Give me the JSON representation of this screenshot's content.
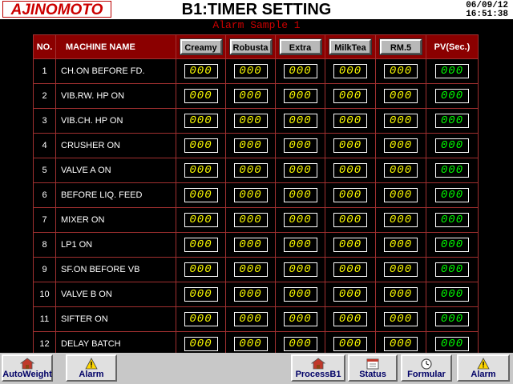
{
  "header": {
    "logo": "AJINOMOTO",
    "title": "B1:TIMER SETTING",
    "date": "06/09/12",
    "time": "16:51:38"
  },
  "alarm_banner": "Alarm Sample 1",
  "table": {
    "col_no": "NO.",
    "col_name": "MACHINE NAME",
    "col_buttons": [
      "Creamy",
      "Robusta",
      "Extra",
      "MilkTea",
      "RM.5"
    ],
    "col_pv": "PV(Sec.)",
    "rows": [
      {
        "no": "1",
        "name": "CH.ON BEFORE FD.",
        "values": [
          "000",
          "000",
          "000",
          "000",
          "000"
        ],
        "pv": "000"
      },
      {
        "no": "2",
        "name": "VIB.RW. HP ON",
        "values": [
          "000",
          "000",
          "000",
          "000",
          "000"
        ],
        "pv": "000"
      },
      {
        "no": "3",
        "name": "VIB.CH. HP ON",
        "values": [
          "000",
          "000",
          "000",
          "000",
          "000"
        ],
        "pv": "000"
      },
      {
        "no": "4",
        "name": "CRUSHER ON",
        "values": [
          "000",
          "000",
          "000",
          "000",
          "000"
        ],
        "pv": "000"
      },
      {
        "no": "5",
        "name": "VALVE A ON",
        "values": [
          "000",
          "000",
          "000",
          "000",
          "000"
        ],
        "pv": "000"
      },
      {
        "no": "6",
        "name": "BEFORE LIQ. FEED",
        "values": [
          "000",
          "000",
          "000",
          "000",
          "000"
        ],
        "pv": "000"
      },
      {
        "no": "7",
        "name": "MIXER ON",
        "values": [
          "000",
          "000",
          "000",
          "000",
          "000"
        ],
        "pv": "000"
      },
      {
        "no": "8",
        "name": "LP1 ON",
        "values": [
          "000",
          "000",
          "000",
          "000",
          "000"
        ],
        "pv": "000"
      },
      {
        "no": "9",
        "name": "SF.ON BEFORE VB",
        "values": [
          "000",
          "000",
          "000",
          "000",
          "000"
        ],
        "pv": "000"
      },
      {
        "no": "10",
        "name": "VALVE B ON",
        "values": [
          "000",
          "000",
          "000",
          "000",
          "000"
        ],
        "pv": "000"
      },
      {
        "no": "11",
        "name": "SIFTER ON",
        "values": [
          "000",
          "000",
          "000",
          "000",
          "000"
        ],
        "pv": "000"
      },
      {
        "no": "12",
        "name": "DELAY BATCH",
        "values": [
          "000",
          "000",
          "000",
          "000",
          "000"
        ],
        "pv": "000"
      }
    ]
  },
  "toolbar": {
    "autoweight": "AutoWeight",
    "alarm_left": "Alarm",
    "processb1": "ProcessB1",
    "status": "Status",
    "formular": "Formular",
    "alarm_right": "Alarm"
  },
  "colors": {
    "background": "#000000",
    "header_cell": "#8b0000",
    "grid_line": "#a03030",
    "set_value": "#ffff00",
    "pv_value": "#00ff00",
    "alarm_text": "#cc0000"
  }
}
